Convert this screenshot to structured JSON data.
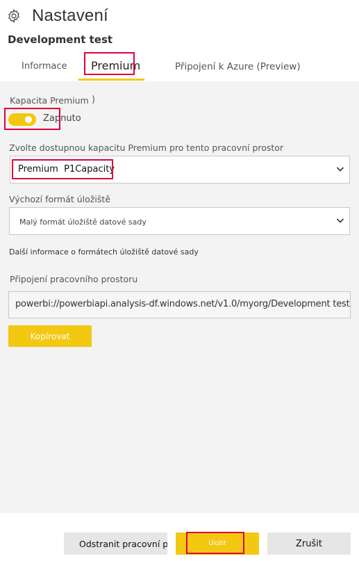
{
  "header": {
    "icon": "gear-icon",
    "title": "Nastavení",
    "workspace_name": "Development test"
  },
  "tabs": [
    {
      "label": "Informace",
      "active": false
    },
    {
      "label": "Premium",
      "active": true
    },
    {
      "label": "Připojení k Azure (Preview)",
      "active": false
    }
  ],
  "premium": {
    "capacity_label": "Kapacita Premium",
    "capacity_paren": ")",
    "toggle_state": "Zapnuto",
    "choose_capacity_label": "Zvolte dostupnou kapacitu Premium pro tento pracovní prostor",
    "selected_capacity": "Premium  P1Capacity",
    "storage_format_label": "Výchozí formát úložiště",
    "storage_format_value": "Malý formát úložiště datové sady",
    "more_info_link": "Další informace o formátech úložiště datové sady",
    "connection_label": "Připojení pracovního prostoru",
    "connection_url": "powerbi://powerbiapi.analysis-df.windows.net/v1.0/myorg/Development test",
    "copy_label": "Kopírovat"
  },
  "footer": {
    "delete_label": "Odstranit pracovní prostor",
    "save_label": "Uložit",
    "cancel_label": "Zrušit"
  },
  "colors": {
    "accent": "#f2c811",
    "highlight": "#e0003c",
    "panel_bg": "#f3f3f3"
  }
}
